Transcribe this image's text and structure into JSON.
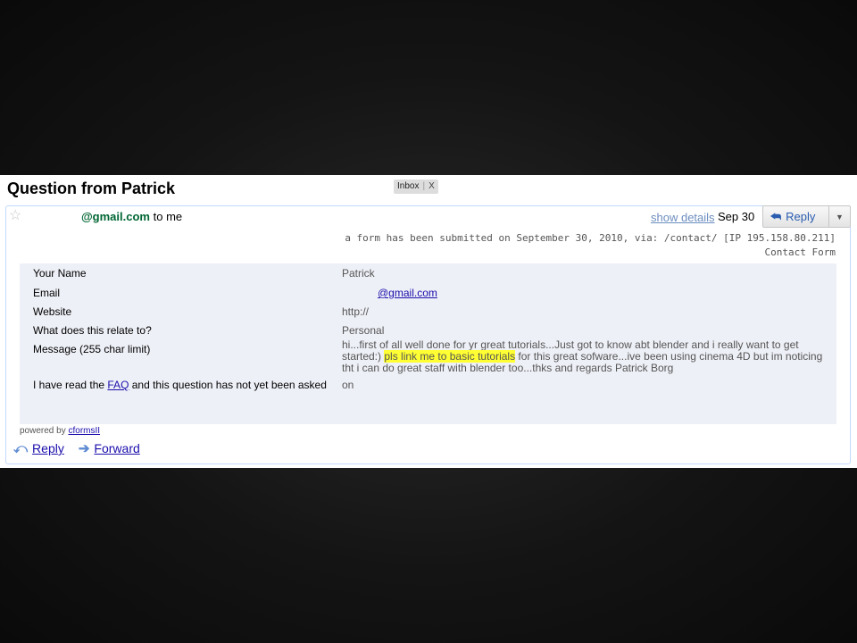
{
  "email": {
    "subject": "Question from Patrick",
    "label": {
      "name": "Inbox",
      "remove": "X"
    },
    "sender_address": "@gmail.com",
    "recipient_text": "to me",
    "show_details": "show details",
    "date": "Sep 30",
    "reply_button": "Reply",
    "meta_line1": "a form has been submitted on September 30, 2010, via: /contact/ [IP 195.158.80.211]",
    "meta_line2": "Contact Form"
  },
  "form": {
    "rows": [
      {
        "key": "Your Name",
        "value": "Patrick"
      },
      {
        "key": "Email",
        "value": "@gmail.com"
      },
      {
        "key": "Website",
        "value": "http://"
      },
      {
        "key": "What does this relate to?",
        "value": "Personal"
      },
      {
        "key": "Message (255 char limit)"
      }
    ],
    "message": {
      "before": "hi...first of all well done for yr great tutorials...Just got to know abt blender and i really want to get started:) ",
      "highlight": "pls link me to basic tutorials",
      "after": " for this great sofware...ive been using cinema 4D but im noticing tht i can do great staff with blender too...thks and regards Patrick Borg"
    },
    "faq_row": {
      "before": "I have read the ",
      "link": "FAQ",
      "after": " and this question has not yet been asked",
      "value": "on"
    }
  },
  "footer": {
    "powered_by": "powered by ",
    "powered_link": "cformsII",
    "reply": "Reply",
    "forward": "Forward"
  },
  "colors": {
    "sender_green": "#006633",
    "highlight": "#ffff33",
    "link_blue": "#1a0dab"
  }
}
